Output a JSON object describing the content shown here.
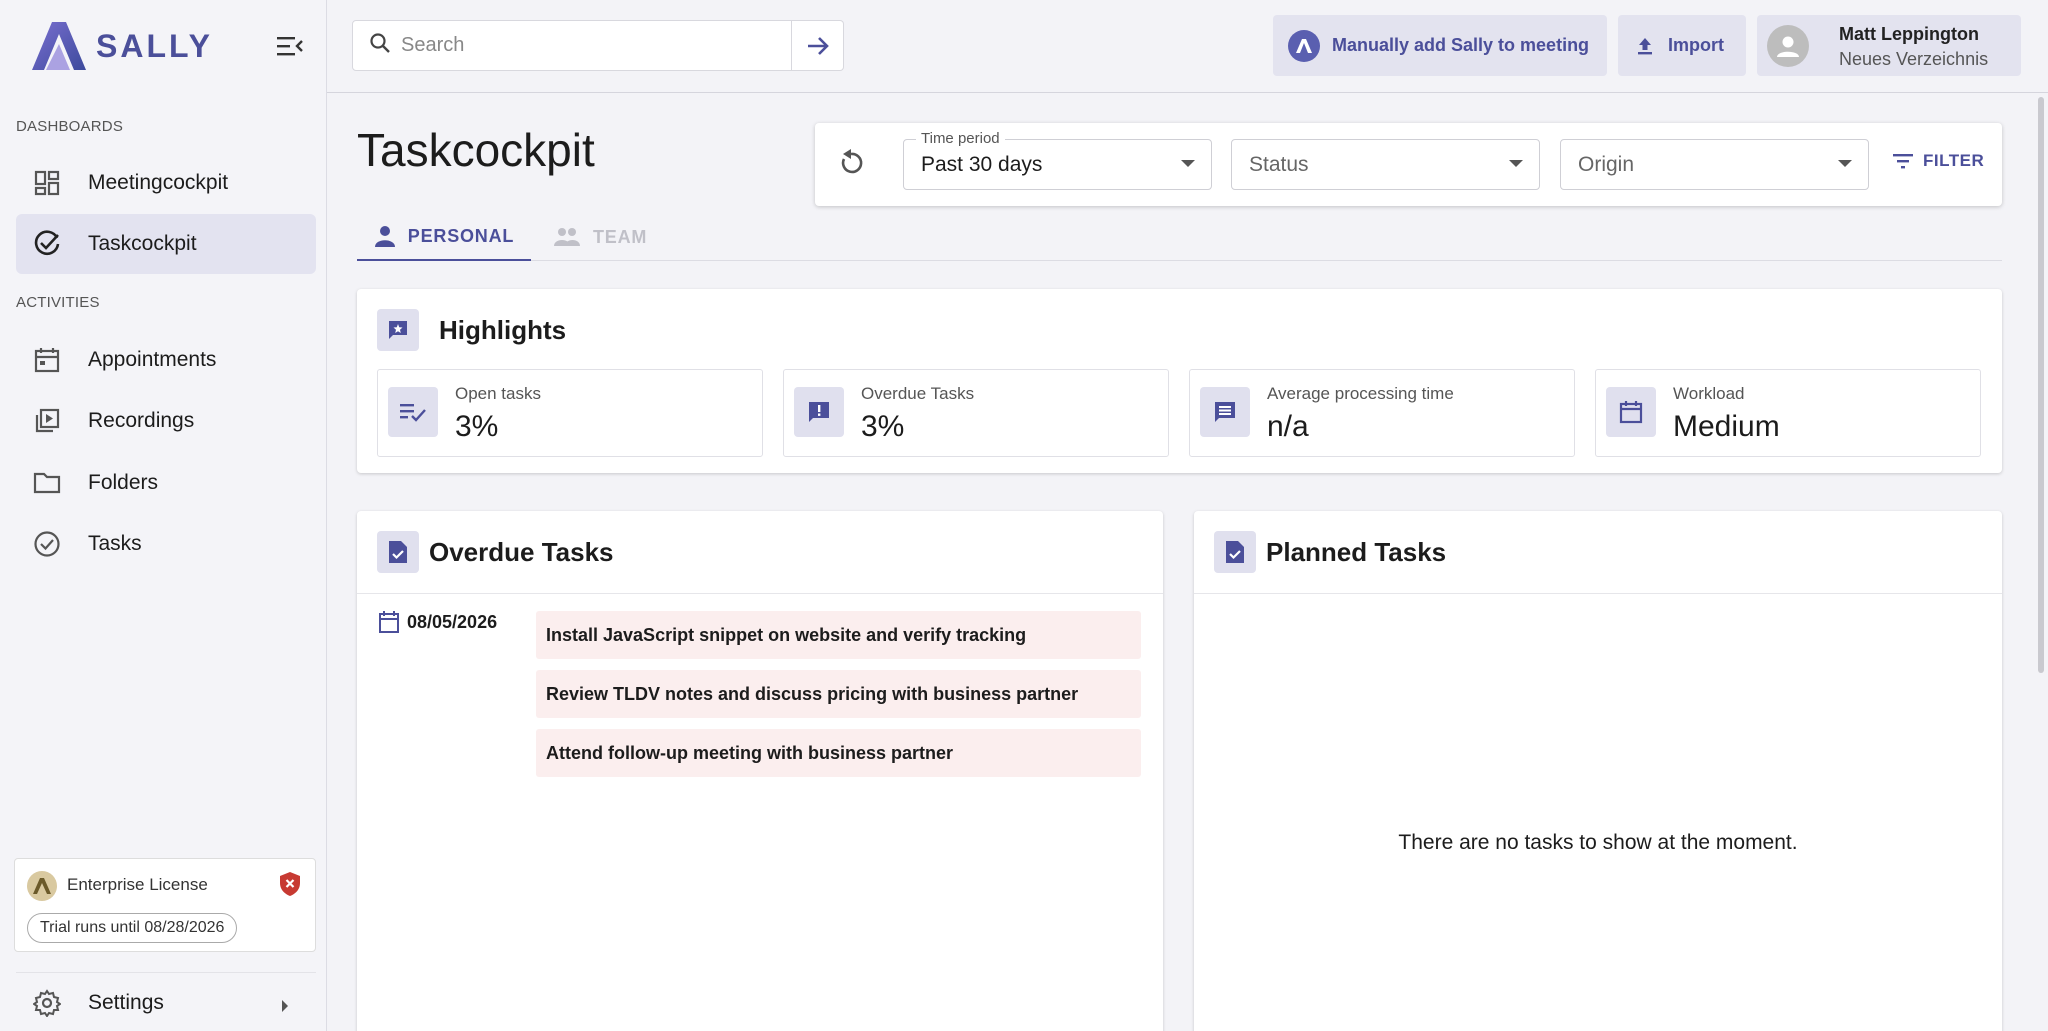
{
  "app": {
    "logo_text": "SALLY"
  },
  "sidebar": {
    "sections": [
      {
        "label": "DASHBOARDS"
      },
      {
        "label": "ACTIVITIES"
      }
    ],
    "items": [
      {
        "label": "Meetingcockpit",
        "icon": "dashboard-icon"
      },
      {
        "label": "Taskcockpit",
        "icon": "check-circle-icon",
        "active": true
      },
      {
        "label": "Appointments",
        "icon": "calendar-icon"
      },
      {
        "label": "Recordings",
        "icon": "video-library-icon"
      },
      {
        "label": "Folders",
        "icon": "folder-icon"
      },
      {
        "label": "Tasks",
        "icon": "check-circle-outline-icon"
      }
    ],
    "license": {
      "title": "Enterprise License",
      "trial": "Trial runs until 08/28/2026"
    },
    "settings_label": "Settings"
  },
  "topbar": {
    "search_placeholder": "Search",
    "add_sally_label": "Manually add Sally to meeting",
    "import_label": "Import",
    "user": {
      "name": "Matt Leppington",
      "directory": "Neues Verzeichnis"
    }
  },
  "page": {
    "title": "Taskcockpit",
    "filters": {
      "time_period_label": "Time period",
      "time_period_value": "Past 30 days",
      "status_placeholder": "Status",
      "origin_placeholder": "Origin",
      "filter_button": "FILTER"
    },
    "tabs": [
      {
        "label": "PERSONAL",
        "active": true
      },
      {
        "label": "TEAM",
        "disabled": true
      }
    ],
    "highlights": {
      "title": "Highlights",
      "stats": [
        {
          "label": "Open tasks",
          "value": "3%",
          "icon": "playlist-check-icon"
        },
        {
          "label": "Overdue Tasks",
          "value": "3%",
          "icon": "feedback-icon"
        },
        {
          "label": "Average processing time",
          "value": "n/a",
          "icon": "comment-icon"
        },
        {
          "label": "Workload",
          "value": "Medium",
          "icon": "calendar-icon"
        }
      ]
    },
    "overdue": {
      "title": "Overdue Tasks",
      "date": "08/05/2026",
      "tasks": [
        "Install JavaScript snippet on website and verify tracking",
        "Review TLDV notes and discuss pricing with business partner",
        "Attend follow-up meeting with business partner"
      ]
    },
    "planned": {
      "title": "Planned Tasks",
      "empty_message": "There are no tasks to show at the moment."
    }
  },
  "colors": {
    "accent": "#4b4f9a",
    "overdue_bg": "#fbeeee",
    "active_nav": "#e3e3f0"
  }
}
